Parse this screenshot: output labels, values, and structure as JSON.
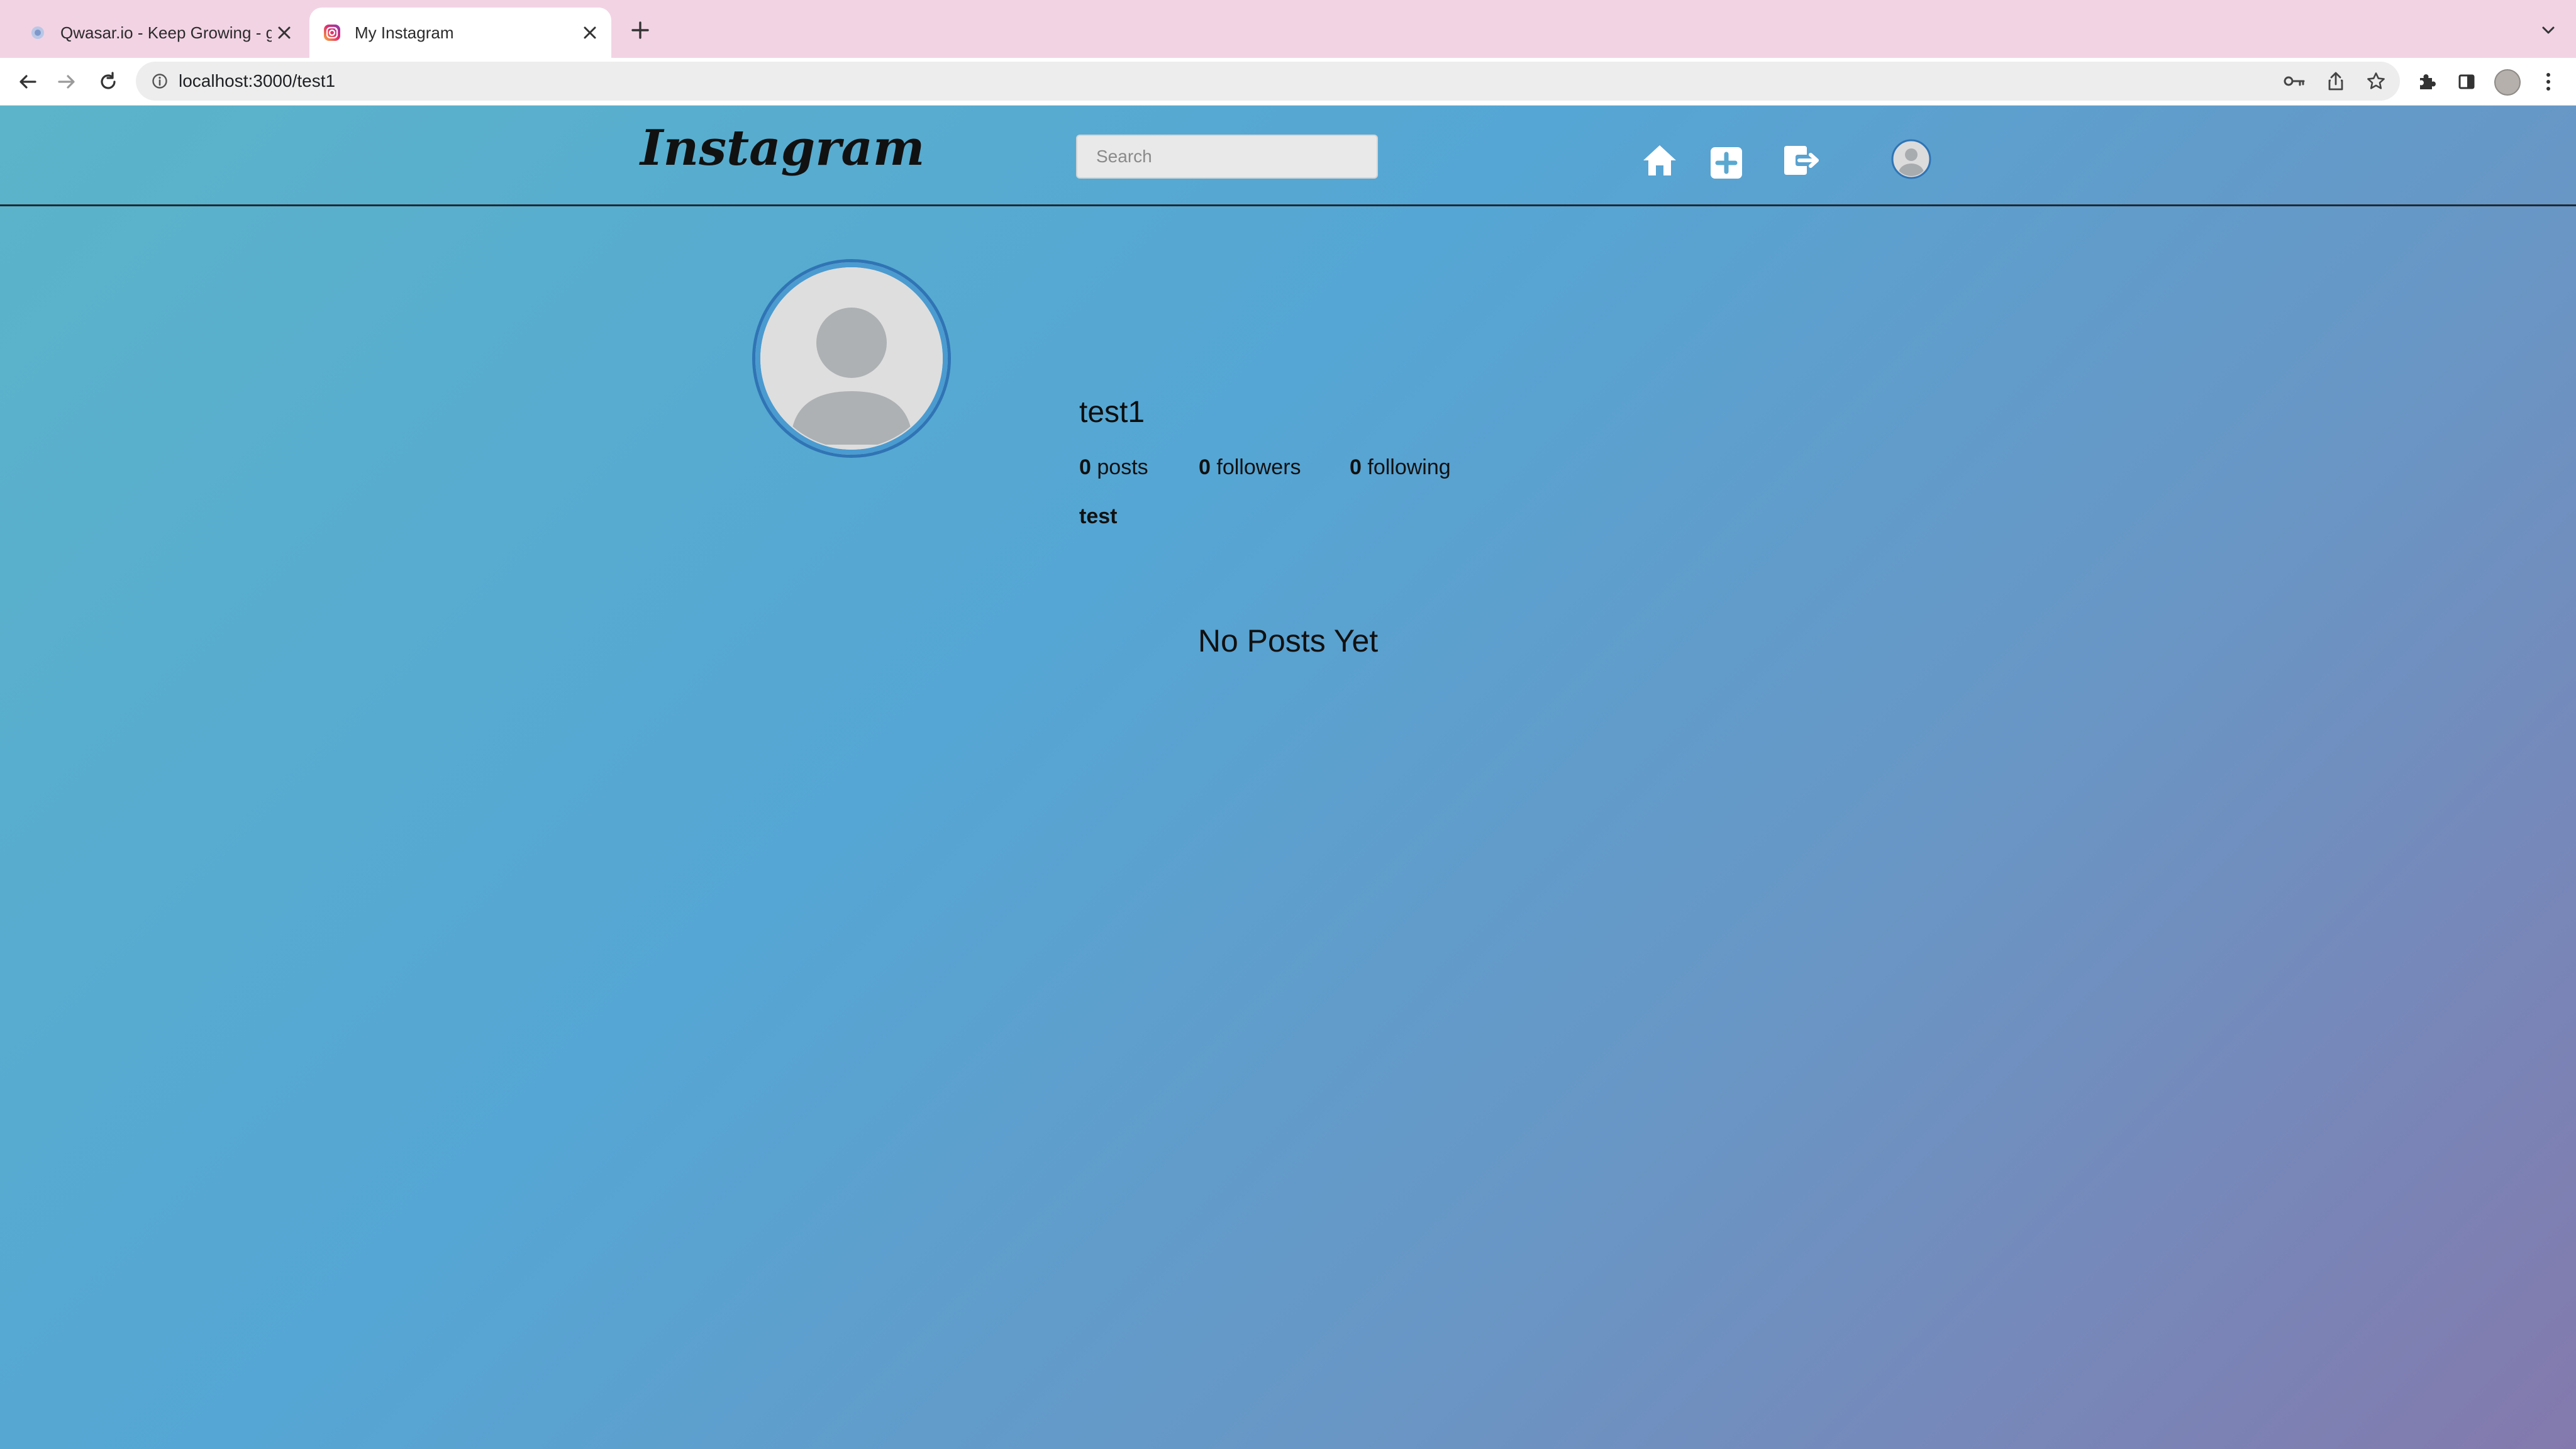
{
  "browser": {
    "tabs": [
      {
        "title": "Qwasar.io - Keep Growing - gu",
        "active": false,
        "favicon": "qwasar-favicon-icon"
      },
      {
        "title": "My Instagram",
        "active": true,
        "favicon": "instagram-favicon-icon"
      }
    ],
    "url": "localhost:3000/test1"
  },
  "header": {
    "logo": "Instagram",
    "search_placeholder": "Search",
    "nav_icons": [
      "home-icon",
      "add-post-icon",
      "logout-icon",
      "profile-avatar-icon"
    ]
  },
  "profile": {
    "username": "test1",
    "stats": {
      "posts_count": "0",
      "posts_label": "posts",
      "followers_count": "0",
      "followers_label": "followers",
      "following_count": "0",
      "following_label": "following"
    },
    "bio": "test"
  },
  "feed": {
    "empty_message": "No Posts Yet"
  },
  "colors": {
    "tabstrip": "#f2d3e4",
    "page_gradient_start": "#5bb4c9",
    "page_gradient_end": "#8479ad",
    "avatar_ring": "#2f74b5"
  }
}
